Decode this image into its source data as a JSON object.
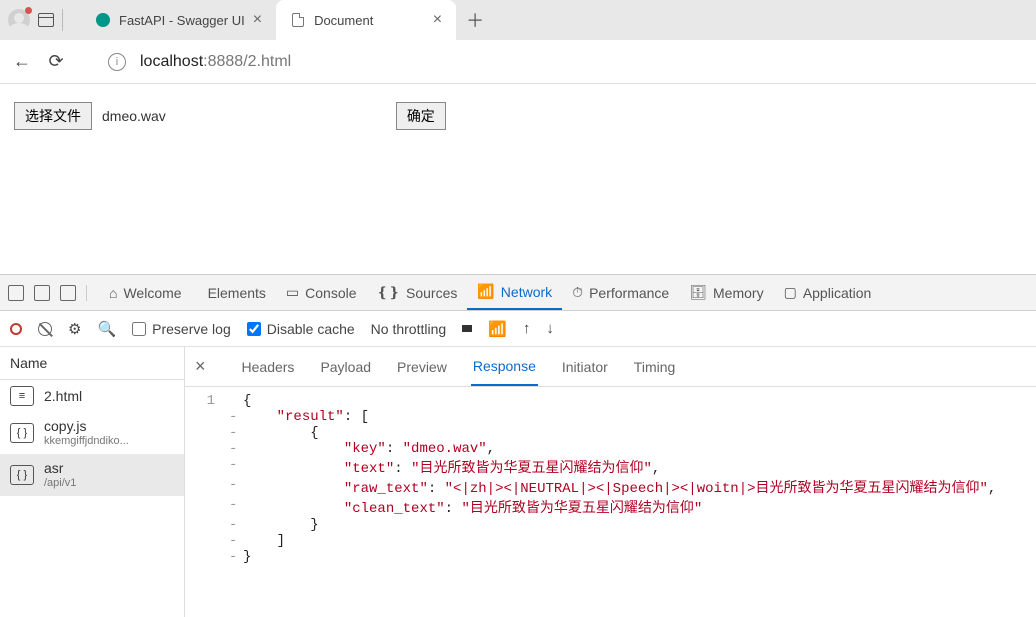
{
  "browser": {
    "tabs": [
      {
        "title": "FastAPI - Swagger UI",
        "active": false
      },
      {
        "title": "Document",
        "active": true
      }
    ],
    "url": {
      "host": "localhost",
      "rest": ":8888/2.html"
    }
  },
  "page": {
    "choose_file_label": "选择文件",
    "chosen_file": "dmeo.wav",
    "submit_label": "确定"
  },
  "devtools": {
    "panels": [
      "Welcome",
      "Elements",
      "Console",
      "Sources",
      "Network",
      "Performance",
      "Memory",
      "Application"
    ],
    "active_panel": "Network",
    "toolbar": {
      "preserve_log": "Preserve log",
      "preserve_log_checked": false,
      "disable_cache": "Disable cache",
      "disable_cache_checked": true,
      "throttling": "No throttling"
    },
    "requests": {
      "header": "Name",
      "items": [
        {
          "name": "2.html",
          "sub": "",
          "icon": "doc",
          "selected": false
        },
        {
          "name": "copy.js",
          "sub": "kkemgiffjdndiko...",
          "icon": "js",
          "selected": false
        },
        {
          "name": "asr",
          "sub": "/api/v1",
          "icon": "xhr",
          "selected": true
        }
      ]
    },
    "detail": {
      "tabs": [
        "Headers",
        "Payload",
        "Preview",
        "Response",
        "Initiator",
        "Timing"
      ],
      "active_tab": "Response",
      "response_lines": [
        {
          "n": "1",
          "fold": "",
          "indent": 0,
          "tokens": [
            {
              "t": "punc",
              "v": "{"
            }
          ]
        },
        {
          "n": "",
          "fold": "-",
          "indent": 1,
          "tokens": [
            {
              "t": "key",
              "v": "\"result\""
            },
            {
              "t": "punc",
              "v": ": ["
            }
          ]
        },
        {
          "n": "",
          "fold": "-",
          "indent": 2,
          "tokens": [
            {
              "t": "punc",
              "v": "{"
            }
          ]
        },
        {
          "n": "",
          "fold": "-",
          "indent": 3,
          "tokens": [
            {
              "t": "key",
              "v": "\"key\""
            },
            {
              "t": "punc",
              "v": ": "
            },
            {
              "t": "str",
              "v": "\"dmeo.wav\""
            },
            {
              "t": "punc",
              "v": ","
            }
          ]
        },
        {
          "n": "",
          "fold": "-",
          "indent": 3,
          "tokens": [
            {
              "t": "key",
              "v": "\"text\""
            },
            {
              "t": "punc",
              "v": ": "
            },
            {
              "t": "str",
              "v": "\"目光所致皆为华夏五星闪耀结为信仰\""
            },
            {
              "t": "punc",
              "v": ","
            }
          ]
        },
        {
          "n": "",
          "fold": "-",
          "indent": 3,
          "tokens": [
            {
              "t": "key",
              "v": "\"raw_text\""
            },
            {
              "t": "punc",
              "v": ": "
            },
            {
              "t": "str",
              "v": "\"<|zh|><|NEUTRAL|><|Speech|><|woitn|>目光所致皆为华夏五星闪耀结为信仰\""
            },
            {
              "t": "punc",
              "v": ","
            }
          ]
        },
        {
          "n": "",
          "fold": "-",
          "indent": 3,
          "tokens": [
            {
              "t": "key",
              "v": "\"clean_text\""
            },
            {
              "t": "punc",
              "v": ": "
            },
            {
              "t": "str",
              "v": "\"目光所致皆为华夏五星闪耀结为信仰\""
            }
          ]
        },
        {
          "n": "",
          "fold": "-",
          "indent": 2,
          "tokens": [
            {
              "t": "punc",
              "v": "}"
            }
          ]
        },
        {
          "n": "",
          "fold": "-",
          "indent": 1,
          "tokens": [
            {
              "t": "punc",
              "v": "]"
            }
          ]
        },
        {
          "n": "",
          "fold": "-",
          "indent": 0,
          "tokens": [
            {
              "t": "punc",
              "v": "}"
            }
          ]
        }
      ]
    }
  }
}
